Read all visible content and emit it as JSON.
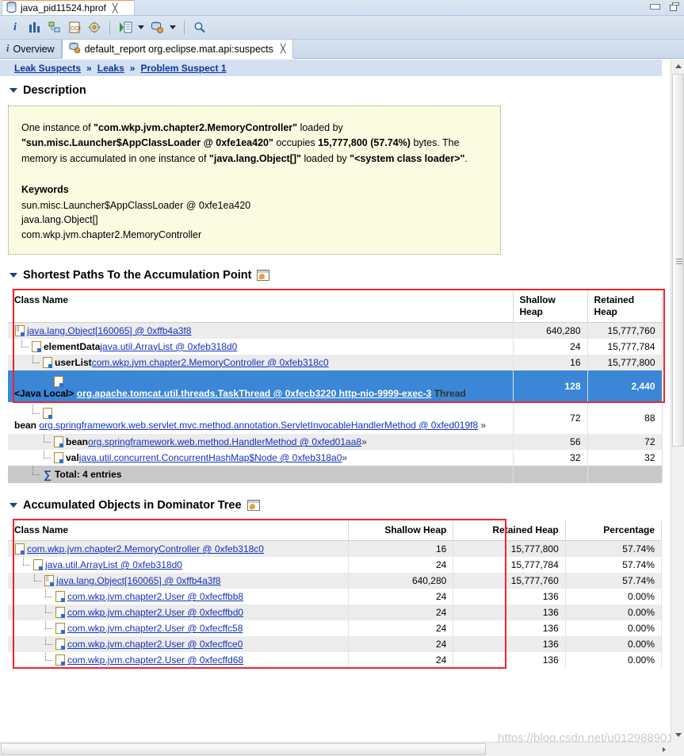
{
  "window": {
    "editor_tab": "java_pid11524.hprof",
    "editor_tab_close": "╳",
    "minimize": "minimize",
    "restore": "restore"
  },
  "toolbar": {
    "buttons": [
      {
        "name": "overview-info",
        "label": "i"
      },
      {
        "name": "histogram",
        "label": "histogram-icon"
      },
      {
        "name": "dominator-tree",
        "label": "dominator-tree-icon"
      },
      {
        "name": "oql",
        "label": "OQL"
      },
      {
        "name": "leak-report",
        "label": "leak-report-icon"
      },
      {
        "name": "run-expert-system-test",
        "label": "run-icon"
      },
      {
        "name": "query-browser",
        "label": "query-browser-icon"
      },
      {
        "name": "search",
        "label": "search-icon"
      }
    ]
  },
  "view_tabs": [
    {
      "label": "Overview",
      "icon": "info-icon",
      "active": false,
      "closable": false
    },
    {
      "label": "default_report org.eclipse.mat.api:suspects",
      "icon": "report-icon",
      "active": true,
      "closable": true,
      "close": "╳"
    }
  ],
  "breadcrumb": {
    "items": [
      "Leak Suspects",
      "Leaks",
      "Problem Suspect 1"
    ],
    "separator": "»"
  },
  "sections": {
    "description": {
      "title": "Description",
      "paragraph": [
        {
          "t": "One instance of ",
          "b": false
        },
        {
          "t": "\"com.wkp.jvm.chapter2.MemoryController\"",
          "b": true
        },
        {
          "t": " loaded by ",
          "b": false
        },
        {
          "t": "\"sun.misc.Launcher$AppClassLoader @ 0xfe1ea420\"",
          "b": true
        },
        {
          "t": " occupies ",
          "b": false
        },
        {
          "t": "15,777,800 (57.74%)",
          "b": true
        },
        {
          "t": " bytes. The memory is accumulated in one instance of ",
          "b": false
        },
        {
          "t": "\"java.lang.Object[]\"",
          "b": true
        },
        {
          "t": " loaded by ",
          "b": false
        },
        {
          "t": "\"<system class loader>\"",
          "b": true
        },
        {
          "t": ".",
          "b": false
        }
      ],
      "keywords_title": "Keywords",
      "keywords": [
        "sun.misc.Launcher$AppClassLoader @ 0xfe1ea420",
        "java.lang.Object[]",
        "com.wkp.jvm.chapter2.MemoryController"
      ]
    },
    "shortest_paths": {
      "title": "Shortest Paths To the Accumulation Point",
      "columns": [
        "Class Name",
        "Shallow\nHeap",
        "Retained\nHeap"
      ],
      "columns_flat": [
        "Class Name",
        "Shallow Heap",
        "Retained Heap"
      ],
      "rows": [
        {
          "indent": 0,
          "icon": "array-icon",
          "field": "",
          "link": "java.lang.Object[160065] @ 0xffb4a3f8",
          "suffix": "",
          "shallow": "640,280",
          "retained": "15,777,760",
          "style": "alt"
        },
        {
          "indent": 1,
          "icon": "doc-icon",
          "field": "elementData",
          "link": "java.util.ArrayList @ 0xfeb318d0",
          "suffix": "",
          "shallow": "24",
          "retained": "15,777,784",
          "style": "plain"
        },
        {
          "indent": 2,
          "icon": "doc-icon",
          "field": "userList",
          "link": "com.wkp.jvm.chapter2.MemoryController @ 0xfeb318c0",
          "suffix": "",
          "shallow": "16",
          "retained": "15,777,800",
          "style": "alt"
        },
        {
          "indent": 3,
          "icon": "doc-icon",
          "field": "<Java Local>",
          "link": "org.apache.tomcat.util.threads.TaskThread @ 0xfecb3220 http-nio-9999-exec-3",
          "suffix": " Thread",
          "shallow": "128",
          "retained": "2,440",
          "style": "selected",
          "wrapped": true
        },
        {
          "indent": 2,
          "icon": "doc-icon",
          "field": "bean",
          "link": "org.springframework.web.servlet.mvc.method.annotation.ServletInvocableHandlerMethod @ 0xfed019f8",
          "suffix": " »",
          "shallow": "72",
          "retained": "88",
          "style": "plain",
          "wrapped": true
        },
        {
          "indent": 3,
          "icon": "doc-icon",
          "field": "bean",
          "link": "org.springframework.web.method.HandlerMethod @ 0xfed01aa8",
          "suffix": " »",
          "shallow": "56",
          "retained": "72",
          "style": "alt"
        },
        {
          "indent": 3,
          "icon": "doc-icon",
          "field": "val",
          "link": "java.util.concurrent.ConcurrentHashMap$Node @ 0xfeb318a0",
          "suffix": " »",
          "shallow": "32",
          "retained": "32",
          "style": "plain"
        }
      ],
      "total_label": "Total: 4 entries",
      "total_sigma": "∑"
    },
    "dominator_tree": {
      "title": "Accumulated Objects in Dominator Tree",
      "columns": [
        "Class Name",
        "Shallow Heap",
        "Retained Heap",
        "Percentage"
      ],
      "rows": [
        {
          "indent": 0,
          "link": "com.wkp.jvm.chapter2.MemoryController @ 0xfeb318c0",
          "shallow": "16",
          "retained": "15,777,800",
          "pct": "57.74%",
          "style": "alt",
          "icon": "doc-icon"
        },
        {
          "indent": 1,
          "link": "java.util.ArrayList @ 0xfeb318d0",
          "shallow": "24",
          "retained": "15,777,784",
          "pct": "57.74%",
          "style": "plain",
          "icon": "doc-icon"
        },
        {
          "indent": 2,
          "link": "java.lang.Object[160065] @ 0xffb4a3f8",
          "shallow": "640,280",
          "retained": "15,777,760",
          "pct": "57.74%",
          "style": "alt",
          "icon": "array-icon"
        },
        {
          "indent": 3,
          "link": "com.wkp.jvm.chapter2.User @ 0xfecffbb8",
          "shallow": "24",
          "retained": "136",
          "pct": "0.00%",
          "style": "plain",
          "icon": "doc-icon"
        },
        {
          "indent": 3,
          "link": "com.wkp.jvm.chapter2.User @ 0xfecffbd0",
          "shallow": "24",
          "retained": "136",
          "pct": "0.00%",
          "style": "alt",
          "icon": "doc-icon"
        },
        {
          "indent": 3,
          "link": "com.wkp.jvm.chapter2.User @ 0xfecffc58",
          "shallow": "24",
          "retained": "136",
          "pct": "0.00%",
          "style": "plain",
          "icon": "doc-icon"
        },
        {
          "indent": 3,
          "link": "com.wkp.jvm.chapter2.User @ 0xfecffce0",
          "shallow": "24",
          "retained": "136",
          "pct": "0.00%",
          "style": "alt",
          "icon": "doc-icon"
        },
        {
          "indent": 3,
          "link": "com.wkp.jvm.chapter2.User @ 0xfecffd68",
          "shallow": "24",
          "retained": "136",
          "pct": "0.00%",
          "style": "plain",
          "icon": "doc-icon"
        }
      ]
    }
  },
  "watermark": "https://blog.csdn.net/u012988901",
  "colors": {
    "selection": "#3b86d6",
    "highlight_box": "#f5222d",
    "description_bg": "#fbfbe2",
    "link": "#1133bb",
    "breadcrumb_bg": "#d3e0f0"
  }
}
